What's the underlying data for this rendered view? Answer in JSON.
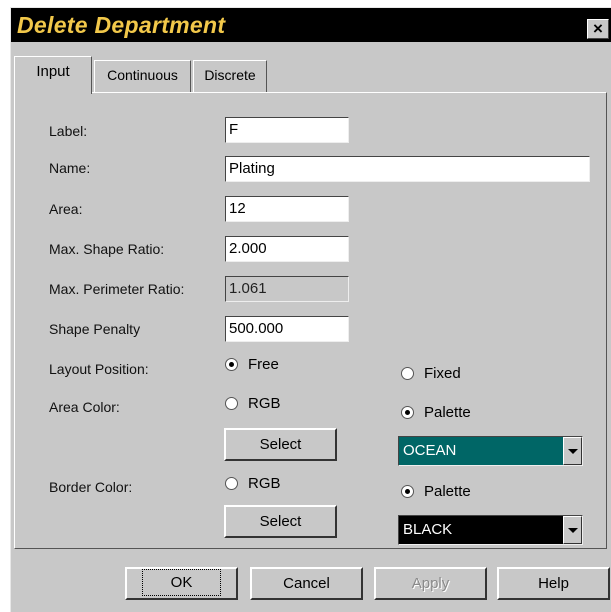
{
  "window": {
    "title": "Delete Department",
    "close_glyph": "×"
  },
  "tabs": [
    {
      "label": "Input",
      "active": true
    },
    {
      "label": "Continuous",
      "active": false
    },
    {
      "label": "Discrete",
      "active": false
    }
  ],
  "form": {
    "label": {
      "label": "Label:",
      "value": "F"
    },
    "name": {
      "label": "Name:",
      "value": "Plating"
    },
    "area": {
      "label": "Area:",
      "value": "12"
    },
    "max_shape_ratio": {
      "label": "Max. Shape Ratio:",
      "value": "2.000"
    },
    "max_perimeter_ratio": {
      "label": "Max. Perimeter Ratio:",
      "value": "1.061"
    },
    "shape_penalty": {
      "label": "Shape Penalty",
      "value": "500.000"
    },
    "layout_position": {
      "label": "Layout Position:",
      "free": "Free",
      "fixed": "Fixed",
      "selected": "Free"
    },
    "area_color": {
      "label": "Area Color:",
      "rgb": "RGB",
      "palette": "Palette",
      "selected": "Palette",
      "select_button": "Select",
      "palette_value": "OCEAN",
      "palette_color": "#006666"
    },
    "border_color": {
      "label": "Border Color:",
      "rgb": "RGB",
      "palette": "Palette",
      "selected": "Palette",
      "select_button": "Select",
      "palette_value": "BLACK",
      "palette_color": "#000000"
    }
  },
  "buttons": {
    "ok": "OK",
    "cancel": "Cancel",
    "apply": "Apply",
    "help": "Help"
  },
  "colors": {
    "dialog_bg": "#c8c8c8",
    "title_bar": "#000000",
    "title_text": "#f2c84a"
  }
}
